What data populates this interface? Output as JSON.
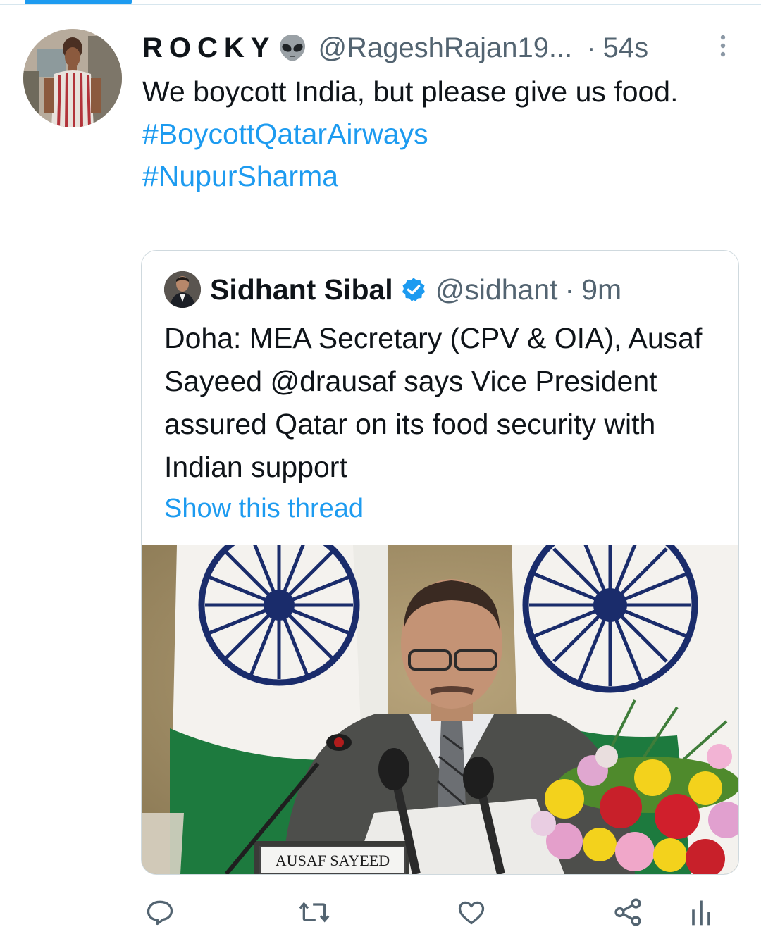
{
  "tweet": {
    "display_name": "ROCKY",
    "handle": "@RageshRajan19...",
    "time": "54s",
    "text": "We boycott India, but please give us food.",
    "hashtags": [
      "#BoycottQatarAirways",
      "#NupurSharma"
    ]
  },
  "quoted": {
    "display_name": "Sidhant Sibal",
    "handle": "@sidhant",
    "time": "9m",
    "text": "Doha: MEA Secretary (CPV & OIA), Ausaf Sayeed @drausaf  says Vice President assured Qatar on its food security with Indian support",
    "show_thread": "Show this thread",
    "image_nameplate": "AUSAF SAYEED"
  },
  "actions": [
    "reply-icon",
    "retweet-icon",
    "like-icon",
    "share-icon",
    "analytics-icon"
  ],
  "colors": {
    "accent": "#1d9bf0",
    "secondary_text": "#536471",
    "border": "#cfd9de"
  }
}
